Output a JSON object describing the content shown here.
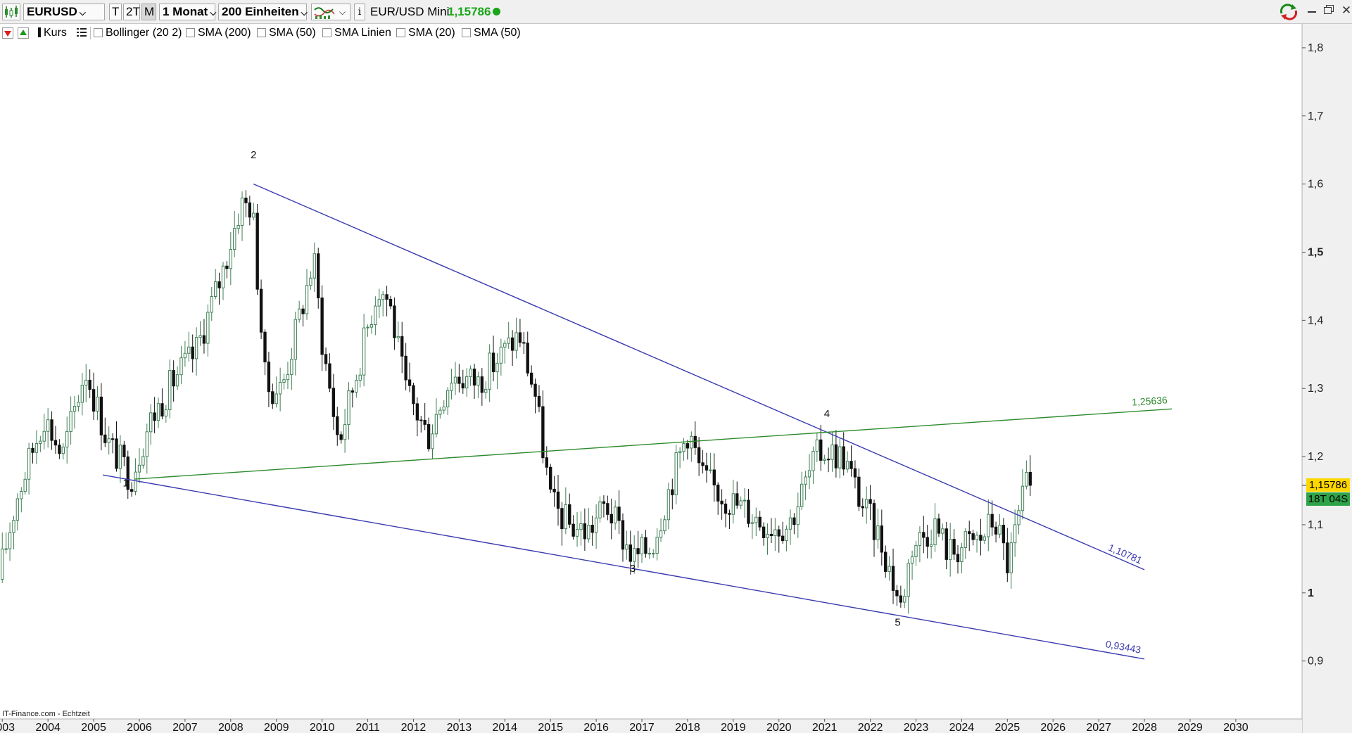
{
  "toolbar": {
    "symbol": "EURUSD",
    "tf_t": "T",
    "tf_2t": "2T",
    "tf_m": "M",
    "period": "1 Monat",
    "units": "200 Einheiten",
    "instrument": "EUR/USD Mini",
    "price": "1,15786",
    "status_color": "#19a619"
  },
  "indicators": {
    "kurs": "Kurs",
    "items": [
      "Bollinger (20 2)",
      "SMA (200)",
      "SMA (50)",
      "SMA Linien",
      "SMA (20)",
      "SMA (50)"
    ]
  },
  "footer": {
    "source": "IT-Finance.com - Echtzeit"
  },
  "price_badge": {
    "value": "1,15786",
    "countdown": "18T 04S",
    "value_bg": "#ffd700",
    "countdown_bg": "#2ea34a"
  },
  "chart_data": {
    "type": "candlestick",
    "instrument": "EUR/USD",
    "interval": "1 Monat",
    "x_range": [
      2002.95,
      2031.45
    ],
    "ylim": [
      0.815,
      1.835
    ],
    "y_ticks": [
      {
        "value": 0.9,
        "label": "0,9"
      },
      {
        "value": 1.0,
        "label": "1",
        "bold": true
      },
      {
        "value": 1.1,
        "label": "1,1"
      },
      {
        "value": 1.2,
        "label": "1,2"
      },
      {
        "value": 1.3,
        "label": "1,3"
      },
      {
        "value": 1.4,
        "label": "1,4"
      },
      {
        "value": 1.5,
        "label": "1,5",
        "bold": true
      },
      {
        "value": 1.6,
        "label": "1,6"
      },
      {
        "value": 1.7,
        "label": "1,7"
      },
      {
        "value": 1.8,
        "label": "1,8"
      }
    ],
    "x_ticks": [
      "2003",
      "2004",
      "2005",
      "2006",
      "2007",
      "2008",
      "2009",
      "2010",
      "2011",
      "2012",
      "2013",
      "2014",
      "2015",
      "2016",
      "2017",
      "2018",
      "2019",
      "2020",
      "2021",
      "2022",
      "2023",
      "2024",
      "2025",
      "2026",
      "2027",
      "2028",
      "2029",
      "2030"
    ],
    "anchors": [
      [
        2003.0,
        1.02
      ],
      [
        2003.4,
        1.14
      ],
      [
        2004.0,
        1.26
      ],
      [
        2004.4,
        1.2
      ],
      [
        2004.9,
        1.33
      ],
      [
        2005.4,
        1.22
      ],
      [
        2005.9,
        1.17
      ],
      [
        2006.3,
        1.25
      ],
      [
        2006.9,
        1.32
      ],
      [
        2007.3,
        1.35
      ],
      [
        2007.9,
        1.47
      ],
      [
        2008.3,
        1.57
      ],
      [
        2008.55,
        1.57
      ],
      [
        2008.85,
        1.3
      ],
      [
        2009.2,
        1.3
      ],
      [
        2009.9,
        1.49
      ],
      [
        2010.1,
        1.36
      ],
      [
        2010.45,
        1.22
      ],
      [
        2010.9,
        1.34
      ],
      [
        2011.3,
        1.45
      ],
      [
        2011.55,
        1.43
      ],
      [
        2011.9,
        1.3
      ],
      [
        2012.4,
        1.23
      ],
      [
        2012.9,
        1.32
      ],
      [
        2013.5,
        1.31
      ],
      [
        2014.4,
        1.38
      ],
      [
        2014.75,
        1.29
      ],
      [
        2015.1,
        1.13
      ],
      [
        2015.5,
        1.1
      ],
      [
        2015.9,
        1.09
      ],
      [
        2016.3,
        1.13
      ],
      [
        2016.9,
        1.05
      ],
      [
        2017.3,
        1.07
      ],
      [
        2017.9,
        1.2
      ],
      [
        2018.1,
        1.24
      ],
      [
        2018.4,
        1.17
      ],
      [
        2018.9,
        1.14
      ],
      [
        2019.4,
        1.12
      ],
      [
        2019.8,
        1.1
      ],
      [
        2020.3,
        1.1
      ],
      [
        2020.9,
        1.2
      ],
      [
        2021.1,
        1.21
      ],
      [
        2021.5,
        1.2
      ],
      [
        2021.9,
        1.13
      ],
      [
        2022.3,
        1.08
      ],
      [
        2022.75,
        0.98
      ],
      [
        2023.0,
        1.07
      ],
      [
        2023.5,
        1.1
      ],
      [
        2023.8,
        1.06
      ],
      [
        2024.5,
        1.08
      ],
      [
        2024.8,
        1.11
      ],
      [
        2025.1,
        1.04
      ],
      [
        2025.4,
        1.13
      ],
      [
        2025.5,
        1.158
      ]
    ],
    "trendlines": [
      {
        "id": "upper",
        "color": "#3a3ab0",
        "from": [
          2008.5,
          1.6
        ],
        "to": [
          2028.0,
          1.034
        ],
        "value_label": "1,10781"
      },
      {
        "id": "lower",
        "color": "#3a3ab0",
        "from": [
          2005.2,
          1.173
        ],
        "to": [
          2028.0,
          0.903
        ],
        "value_label": "0,93443"
      },
      {
        "id": "mid",
        "color": "#2e8b2e",
        "from": [
          2005.9,
          1.167
        ],
        "to": [
          2028.6,
          1.27
        ],
        "value_label": "1,25636"
      }
    ],
    "wave_labels": [
      {
        "text": "1",
        "x": 2005.7,
        "y": 1.156
      },
      {
        "text": "2",
        "x": 2008.5,
        "y": 1.638
      },
      {
        "text": "3",
        "x": 2016.8,
        "y": 1.031
      },
      {
        "text": "4",
        "x": 2021.05,
        "y": 1.258
      },
      {
        "text": "5",
        "x": 2022.6,
        "y": 0.952
      }
    ],
    "last_value": 1.15786
  }
}
